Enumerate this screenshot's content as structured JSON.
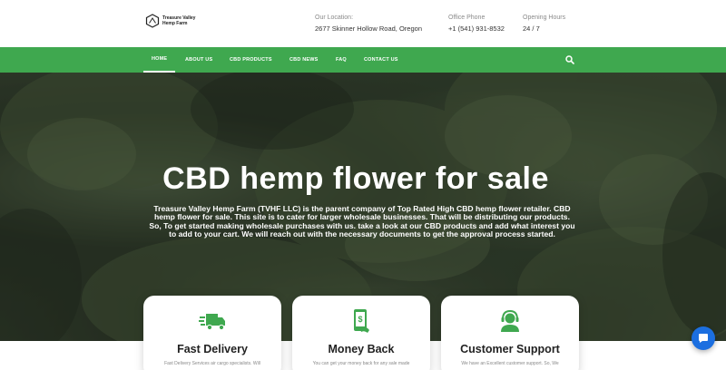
{
  "header": {
    "logo_text": "Treasure Valley Hemp Farm",
    "location": {
      "label": "Our Location:",
      "value": "2677 Skinner Hollow Road, Oregon"
    },
    "phone": {
      "label": "Office Phone",
      "value": "+1 (541) 931-8532"
    },
    "hours": {
      "label": "Opening Hours",
      "value": "24 / 7"
    }
  },
  "nav": {
    "items": [
      {
        "label": "HOME",
        "active": true
      },
      {
        "label": "ABOUT US"
      },
      {
        "label": "CBD PRODUCTS"
      },
      {
        "label": "CBD NEWS"
      },
      {
        "label": "FAQ"
      },
      {
        "label": "CONTACT US"
      }
    ],
    "search_icon": "search-icon",
    "color": "#3fa84f"
  },
  "hero": {
    "title": "CBD hemp flower for sale",
    "description": "Treasure Valley Hemp Farm (TVHF LLC) is the parent company of Top Rated High CBD hemp flower retailer. CBD hemp flower for sale. This site is to cater for larger wholesale businesses. That will be distributing our products. So, To get started making wholesale purchases with us. take a look at our CBD products and add what interest you to add to your cart. We will reach out with the necessary documents to get the approval process started."
  },
  "cards": [
    {
      "icon": "delivery-truck-icon",
      "title": "Fast Delivery",
      "text": "Fast Delivery Services air cargo specialists. Will"
    },
    {
      "icon": "money-back-icon",
      "title": "Money Back",
      "text": "You can get your money back for any sale made"
    },
    {
      "icon": "customer-support-icon",
      "title": "Customer Support",
      "text": "We have an Excellent customer support. So, We"
    }
  ],
  "chat": {
    "icon": "chat-icon",
    "color": "#1c6fe0"
  }
}
